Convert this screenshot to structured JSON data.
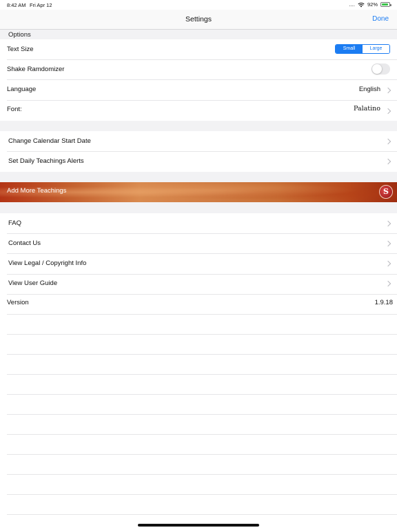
{
  "status_bar": {
    "time": "8:42 AM",
    "date": "Fri Apr 12",
    "signal": "....",
    "battery": "92%"
  },
  "nav": {
    "title": "Settings",
    "done_label": "Done"
  },
  "options": {
    "header": "Options",
    "text_size": {
      "label": "Text Size",
      "options": [
        "Small",
        "Large"
      ],
      "selected": "Small"
    },
    "shake": {
      "label": "Shake Ramdomizer",
      "on": false
    },
    "language": {
      "label": "Language",
      "value": "English"
    },
    "font": {
      "label": "Font:",
      "value": "Palatino"
    }
  },
  "calendar_section": {
    "items": [
      {
        "label": "Change Calendar Start Date"
      },
      {
        "label": "Set Daily Teachings Alerts"
      }
    ]
  },
  "banner": {
    "label": "Add More Teachings",
    "logo_letter": "S"
  },
  "help_section": {
    "items": [
      {
        "label": "FAQ"
      },
      {
        "label": "Contact Us"
      },
      {
        "label": "View Legal / Copyright Info"
      },
      {
        "label": "View User Guide"
      }
    ]
  },
  "version": {
    "label": "Version",
    "value": "1.9.18"
  },
  "colors": {
    "accent": "#1b7cf2",
    "group_background": "#f2f2f4",
    "banner_base": "#c4612f"
  }
}
